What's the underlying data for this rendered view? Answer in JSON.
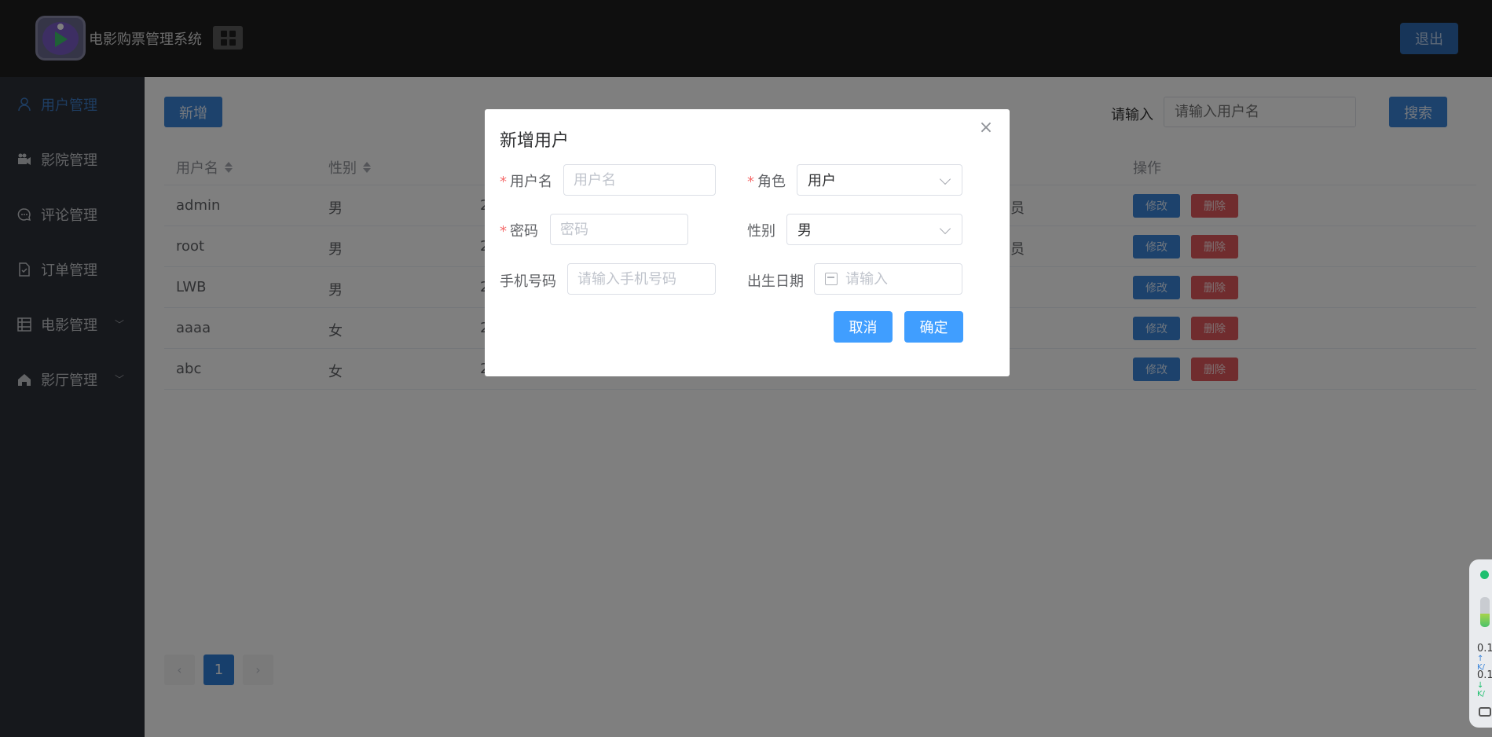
{
  "header": {
    "app_title": "电影购票管理系统",
    "logout_label": "退出"
  },
  "sidebar": {
    "items": [
      {
        "label": "用户管理",
        "icon": "user-icon",
        "active": true
      },
      {
        "label": "影院管理",
        "icon": "camera-icon"
      },
      {
        "label": "评论管理",
        "icon": "chat-icon"
      },
      {
        "label": "订单管理",
        "icon": "document-check-icon"
      },
      {
        "label": "电影管理",
        "icon": "film-grid-icon",
        "expandable": true
      },
      {
        "label": "影厅管理",
        "icon": "home-icon",
        "expandable": true
      }
    ]
  },
  "toolbar": {
    "add_label": "新增",
    "search_label": "请输入",
    "search_placeholder": "请输入用户名",
    "search_button": "搜索"
  },
  "table": {
    "columns": [
      "用户名",
      "性别",
      "操作"
    ],
    "rows": [
      {
        "username": "admin",
        "gender": "男",
        "col3_partial": "2",
        "role_partial": "员",
        "edit": "修改",
        "delete": "删除"
      },
      {
        "username": "root",
        "gender": "男",
        "col3_partial": "2",
        "role_partial": "员",
        "edit": "修改",
        "delete": "删除"
      },
      {
        "username": "LWB",
        "gender": "男",
        "col3_partial": "2",
        "role_partial": "",
        "edit": "修改",
        "delete": "删除"
      },
      {
        "username": "aaaa",
        "gender": "女",
        "col3_partial": "2",
        "role_partial": "",
        "edit": "修改",
        "delete": "删除"
      },
      {
        "username": "abc",
        "gender": "女",
        "col3_partial": "2",
        "role_partial": "",
        "edit": "修改",
        "delete": "删除"
      }
    ]
  },
  "pagination": {
    "current_page": "1",
    "prev": "‹",
    "next": "›"
  },
  "dialog": {
    "title": "新增用户",
    "close": "×",
    "username_label": "用户名",
    "username_placeholder": "用户名",
    "role_label": "角色",
    "role_value": "用户",
    "password_label": "密码",
    "password_placeholder": "密码",
    "gender_label": "性别",
    "gender_value": "男",
    "phone_label": "手机号码",
    "phone_placeholder": "请输入手机号码",
    "birthday_label": "出生日期",
    "birthday_placeholder": "请输入",
    "cancel_label": "取消",
    "confirm_label": "确定",
    "required_mark": "*"
  },
  "widget": {
    "status_color": "#1fbf6f",
    "upload_value": "0.1",
    "upload_unit": "↑ K/",
    "download_value": "0.1",
    "download_unit": "↓ K/",
    "level_fraction": 0.45
  },
  "colors": {
    "accent": "#409eff",
    "primary_dark": "#3a84d9",
    "danger": "#e0585c",
    "sidebar_bg": "#2c3038",
    "header_bg": "#1f1f1f"
  }
}
